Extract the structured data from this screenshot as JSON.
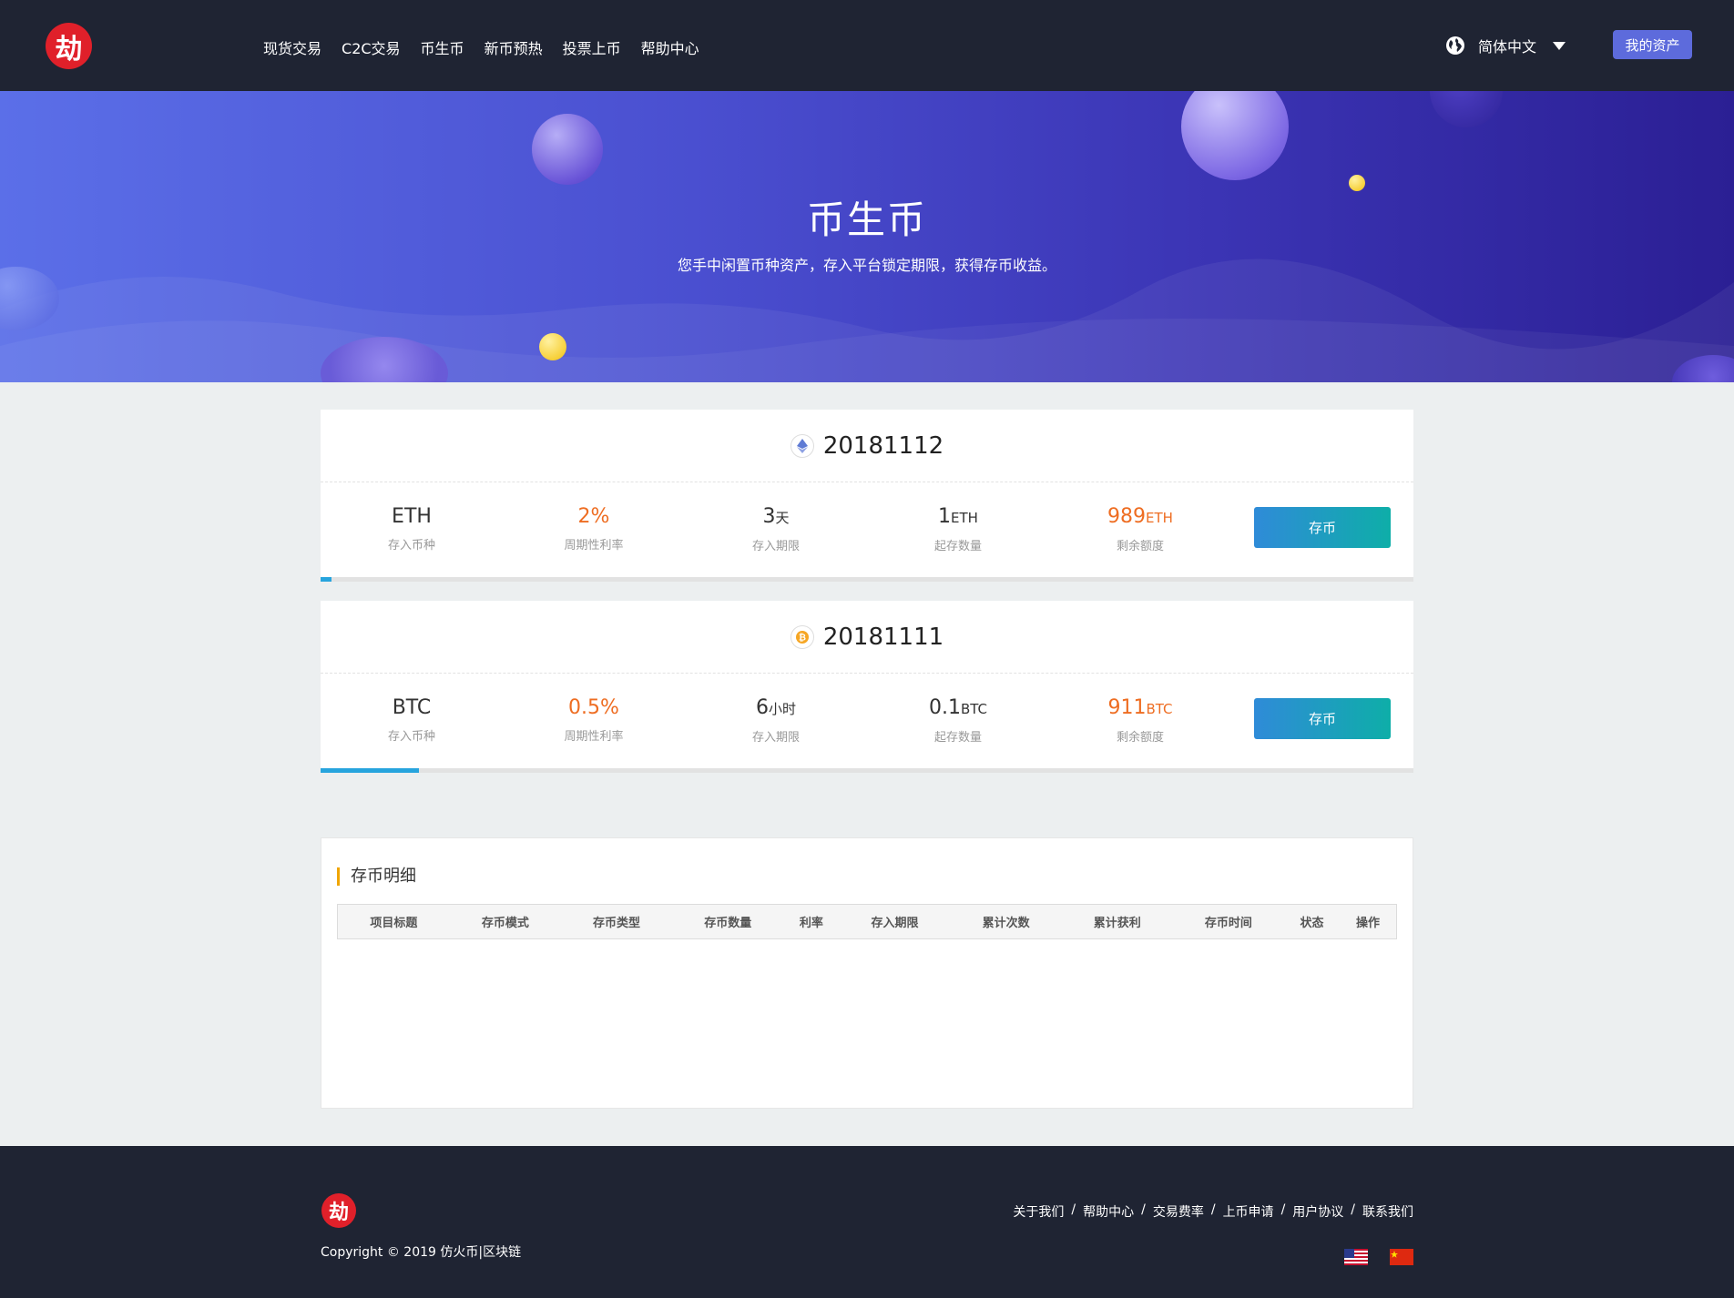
{
  "header": {
    "logo_char": "劫",
    "nav": [
      "现货交易",
      "C2C交易",
      "币生币",
      "新币预热",
      "投票上币",
      "帮助中心"
    ],
    "language": "简体中文",
    "assets_button": "我的资产"
  },
  "banner": {
    "title": "币生币",
    "subtitle": "您手中闲置币种资产，存入平台锁定期限，获得存币收益。"
  },
  "products": [
    {
      "title": "20181112",
      "icon": "ethereum-icon",
      "currency": "ETH",
      "currency_label": "存入币种",
      "rate": "2%",
      "rate_label": "周期性利率",
      "period_value": "3",
      "period_unit": "天",
      "period_label": "存入期限",
      "min_value": "1",
      "min_unit": "ETH",
      "min_label": "起存数量",
      "remaining_value": "989",
      "remaining_unit": "ETH",
      "remaining_label": "剩余额度",
      "button": "存币",
      "progress": 0.01
    },
    {
      "title": "20181111",
      "icon": "bitcoin-icon",
      "currency": "BTC",
      "currency_label": "存入币种",
      "rate": "0.5%",
      "rate_label": "周期性利率",
      "period_value": "6",
      "period_unit": "小时",
      "period_label": "存入期限",
      "min_value": "0.1",
      "min_unit": "BTC",
      "min_label": "起存数量",
      "remaining_value": "911",
      "remaining_unit": "BTC",
      "remaining_label": "剩余额度",
      "button": "存币",
      "progress": 0.09
    }
  ],
  "records": {
    "title": "存币明细",
    "columns": [
      "项目标题",
      "存币模式",
      "存币类型",
      "存币数量",
      "利率",
      "存入期限",
      "累计次数",
      "累计获利",
      "存币时间",
      "状态",
      "操作"
    ]
  },
  "footer": {
    "logo_char": "劫",
    "copyright": "Copyright © 2019 仿火币|区块链",
    "links": [
      "关于我们",
      "帮助中心",
      "交易费率",
      "上币申请",
      "用户协议",
      "联系我们"
    ],
    "flags": [
      "us-flag-icon",
      "china-flag-icon"
    ]
  },
  "colors": {
    "header_bg": "#1f2433",
    "accent_orange": "#ee6d22",
    "button_gradient_start": "#2f8bd8",
    "button_gradient_end": "#0eaea8",
    "progress": "#27a4dd"
  }
}
